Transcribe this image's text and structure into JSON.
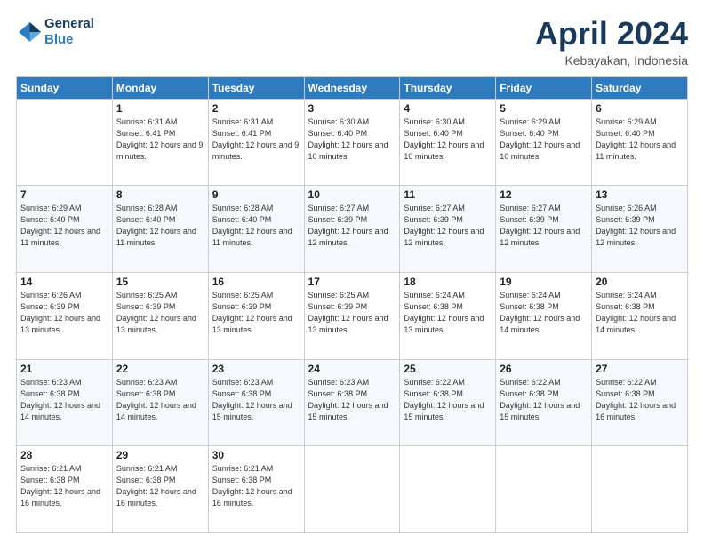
{
  "logo": {
    "line1": "General",
    "line2": "Blue"
  },
  "title": "April 2024",
  "subtitle": "Kebayakan, Indonesia",
  "days_header": [
    "Sunday",
    "Monday",
    "Tuesday",
    "Wednesday",
    "Thursday",
    "Friday",
    "Saturday"
  ],
  "weeks": [
    [
      {
        "day": "",
        "sunrise": "",
        "sunset": "",
        "daylight": ""
      },
      {
        "day": "1",
        "sunrise": "Sunrise: 6:31 AM",
        "sunset": "Sunset: 6:41 PM",
        "daylight": "Daylight: 12 hours and 9 minutes."
      },
      {
        "day": "2",
        "sunrise": "Sunrise: 6:31 AM",
        "sunset": "Sunset: 6:41 PM",
        "daylight": "Daylight: 12 hours and 9 minutes."
      },
      {
        "day": "3",
        "sunrise": "Sunrise: 6:30 AM",
        "sunset": "Sunset: 6:40 PM",
        "daylight": "Daylight: 12 hours and 10 minutes."
      },
      {
        "day": "4",
        "sunrise": "Sunrise: 6:30 AM",
        "sunset": "Sunset: 6:40 PM",
        "daylight": "Daylight: 12 hours and 10 minutes."
      },
      {
        "day": "5",
        "sunrise": "Sunrise: 6:29 AM",
        "sunset": "Sunset: 6:40 PM",
        "daylight": "Daylight: 12 hours and 10 minutes."
      },
      {
        "day": "6",
        "sunrise": "Sunrise: 6:29 AM",
        "sunset": "Sunset: 6:40 PM",
        "daylight": "Daylight: 12 hours and 11 minutes."
      }
    ],
    [
      {
        "day": "7",
        "sunrise": "Sunrise: 6:29 AM",
        "sunset": "Sunset: 6:40 PM",
        "daylight": "Daylight: 12 hours and 11 minutes."
      },
      {
        "day": "8",
        "sunrise": "Sunrise: 6:28 AM",
        "sunset": "Sunset: 6:40 PM",
        "daylight": "Daylight: 12 hours and 11 minutes."
      },
      {
        "day": "9",
        "sunrise": "Sunrise: 6:28 AM",
        "sunset": "Sunset: 6:40 PM",
        "daylight": "Daylight: 12 hours and 11 minutes."
      },
      {
        "day": "10",
        "sunrise": "Sunrise: 6:27 AM",
        "sunset": "Sunset: 6:39 PM",
        "daylight": "Daylight: 12 hours and 12 minutes."
      },
      {
        "day": "11",
        "sunrise": "Sunrise: 6:27 AM",
        "sunset": "Sunset: 6:39 PM",
        "daylight": "Daylight: 12 hours and 12 minutes."
      },
      {
        "day": "12",
        "sunrise": "Sunrise: 6:27 AM",
        "sunset": "Sunset: 6:39 PM",
        "daylight": "Daylight: 12 hours and 12 minutes."
      },
      {
        "day": "13",
        "sunrise": "Sunrise: 6:26 AM",
        "sunset": "Sunset: 6:39 PM",
        "daylight": "Daylight: 12 hours and 12 minutes."
      }
    ],
    [
      {
        "day": "14",
        "sunrise": "Sunrise: 6:26 AM",
        "sunset": "Sunset: 6:39 PM",
        "daylight": "Daylight: 12 hours and 13 minutes."
      },
      {
        "day": "15",
        "sunrise": "Sunrise: 6:25 AM",
        "sunset": "Sunset: 6:39 PM",
        "daylight": "Daylight: 12 hours and 13 minutes."
      },
      {
        "day": "16",
        "sunrise": "Sunrise: 6:25 AM",
        "sunset": "Sunset: 6:39 PM",
        "daylight": "Daylight: 12 hours and 13 minutes."
      },
      {
        "day": "17",
        "sunrise": "Sunrise: 6:25 AM",
        "sunset": "Sunset: 6:39 PM",
        "daylight": "Daylight: 12 hours and 13 minutes."
      },
      {
        "day": "18",
        "sunrise": "Sunrise: 6:24 AM",
        "sunset": "Sunset: 6:38 PM",
        "daylight": "Daylight: 12 hours and 13 minutes."
      },
      {
        "day": "19",
        "sunrise": "Sunrise: 6:24 AM",
        "sunset": "Sunset: 6:38 PM",
        "daylight": "Daylight: 12 hours and 14 minutes."
      },
      {
        "day": "20",
        "sunrise": "Sunrise: 6:24 AM",
        "sunset": "Sunset: 6:38 PM",
        "daylight": "Daylight: 12 hours and 14 minutes."
      }
    ],
    [
      {
        "day": "21",
        "sunrise": "Sunrise: 6:23 AM",
        "sunset": "Sunset: 6:38 PM",
        "daylight": "Daylight: 12 hours and 14 minutes."
      },
      {
        "day": "22",
        "sunrise": "Sunrise: 6:23 AM",
        "sunset": "Sunset: 6:38 PM",
        "daylight": "Daylight: 12 hours and 14 minutes."
      },
      {
        "day": "23",
        "sunrise": "Sunrise: 6:23 AM",
        "sunset": "Sunset: 6:38 PM",
        "daylight": "Daylight: 12 hours and 15 minutes."
      },
      {
        "day": "24",
        "sunrise": "Sunrise: 6:23 AM",
        "sunset": "Sunset: 6:38 PM",
        "daylight": "Daylight: 12 hours and 15 minutes."
      },
      {
        "day": "25",
        "sunrise": "Sunrise: 6:22 AM",
        "sunset": "Sunset: 6:38 PM",
        "daylight": "Daylight: 12 hours and 15 minutes."
      },
      {
        "day": "26",
        "sunrise": "Sunrise: 6:22 AM",
        "sunset": "Sunset: 6:38 PM",
        "daylight": "Daylight: 12 hours and 15 minutes."
      },
      {
        "day": "27",
        "sunrise": "Sunrise: 6:22 AM",
        "sunset": "Sunset: 6:38 PM",
        "daylight": "Daylight: 12 hours and 16 minutes."
      }
    ],
    [
      {
        "day": "28",
        "sunrise": "Sunrise: 6:21 AM",
        "sunset": "Sunset: 6:38 PM",
        "daylight": "Daylight: 12 hours and 16 minutes."
      },
      {
        "day": "29",
        "sunrise": "Sunrise: 6:21 AM",
        "sunset": "Sunset: 6:38 PM",
        "daylight": "Daylight: 12 hours and 16 minutes."
      },
      {
        "day": "30",
        "sunrise": "Sunrise: 6:21 AM",
        "sunset": "Sunset: 6:38 PM",
        "daylight": "Daylight: 12 hours and 16 minutes."
      },
      {
        "day": "",
        "sunrise": "",
        "sunset": "",
        "daylight": ""
      },
      {
        "day": "",
        "sunrise": "",
        "sunset": "",
        "daylight": ""
      },
      {
        "day": "",
        "sunrise": "",
        "sunset": "",
        "daylight": ""
      },
      {
        "day": "",
        "sunrise": "",
        "sunset": "",
        "daylight": ""
      }
    ]
  ]
}
